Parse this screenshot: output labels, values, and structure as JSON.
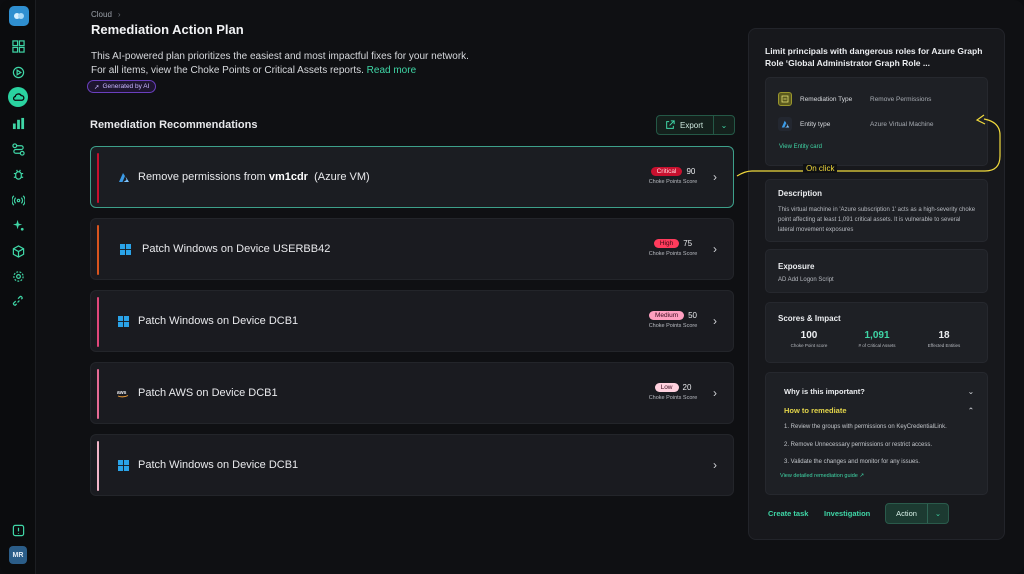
{
  "breadcrumb": {
    "parent": "Cloud",
    "separator": "›"
  },
  "page": {
    "title": "Remediation Action Plan",
    "description_line1": "This AI-powered plan prioritizes the easiest and most impactful fixes for your network.",
    "description_line2": "For all items, view the Choke Points or Critical Assets reports.",
    "read_more": "Read more",
    "ai_badge": "Generated by AI"
  },
  "section": {
    "title": "Remediation Recommendations",
    "export_label": "Export"
  },
  "cards": [
    {
      "title_prefix": "Remove permissions from",
      "title_bold": "vm1cdr",
      "title_suffix": "(Azure VM)",
      "severity": "Critical",
      "score": "90",
      "score_label": "Choke Points Score",
      "icon": "azure-icon"
    },
    {
      "title_prefix": "Patch Windows on Device USERBB42",
      "severity": "High",
      "score": "75",
      "score_label": "Choke Points Score",
      "icon": "windows-icon"
    },
    {
      "title_prefix": "Patch Windows on Device DCB1",
      "severity": "Medium",
      "score": "50",
      "score_label": "Choke Points Score",
      "icon": "windows-icon"
    },
    {
      "title_prefix": "Patch AWS on Device DCB1",
      "severity": "Low",
      "score": "20",
      "score_label": "Choke Points Score",
      "icon": "aws-icon"
    },
    {
      "title_prefix": "Patch Windows on Device DCB1",
      "icon": "windows-icon"
    }
  ],
  "callout": {
    "label": "On click"
  },
  "panel": {
    "title": "Limit principals with dangerous roles for Azure Graph Role ‘Global Administrator Graph Role ...",
    "remediation_type_label": "Remediation Type",
    "remediation_type_value": "Remove Permissions",
    "entity_type_label": "Entity type",
    "entity_type_value": "Azure Virtual Machine",
    "view_entity": "View Entity card",
    "description_title": "Description",
    "description_text": "This virtual machine in 'Azure subscription 1' acts as a high-severity choke point affecting at least 1,091 critical assets. It is vulnerable to several lateral movement exposures",
    "exposure_title": "Exposure",
    "exposure_text": "AD Add Logon Script",
    "scores_title": "Scores & Impact",
    "stats": [
      {
        "value": "100",
        "label": "Choke Point score"
      },
      {
        "value": "1,091",
        "label": "# of Critical Assets"
      },
      {
        "value": "18",
        "label": "Effected Entities"
      }
    ],
    "why_title": "Why is this important?",
    "how_title": "How to remediate",
    "steps": [
      "1. Review the groups with permissions on KeyCredentialLink.",
      "2. Remove Unnecessary permissions or restrict access.",
      "3. Validate the changes and monitor for any issues."
    ],
    "guide_link": "View detailed remediation guide",
    "create_task": "Create task",
    "investigation": "Investigation",
    "action": "Action"
  },
  "user": {
    "initials": "MR"
  },
  "colors": {
    "accent": "#3fd6a6",
    "critical": "#c8102e",
    "high": "#ff3b5c",
    "medium": "#ff9fc0",
    "low": "#ffd1de",
    "callout": "#f0d93c"
  }
}
